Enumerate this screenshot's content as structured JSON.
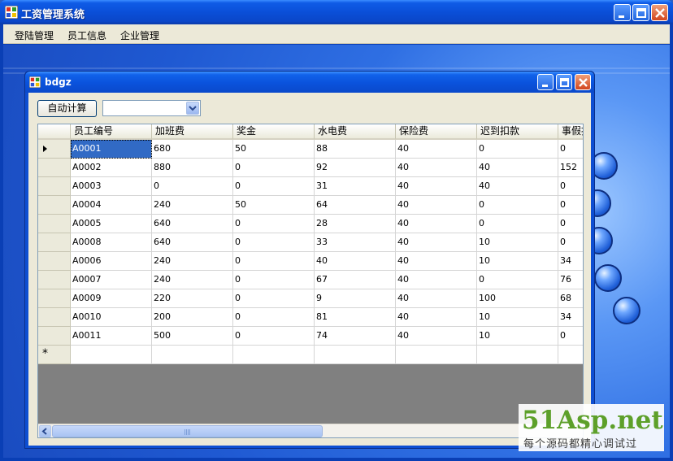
{
  "window": {
    "title": "工资管理系统"
  },
  "menu": [
    {
      "label": "登陆管理"
    },
    {
      "label": "员工信息"
    },
    {
      "label": "企业管理"
    }
  ],
  "child_window": {
    "title": "bdgz"
  },
  "toolbar": {
    "auto_calc_label": "自动计算",
    "combo_value": ""
  },
  "grid": {
    "columns": [
      "员工编号",
      "加班费",
      "奖金",
      "水电费",
      "保险费",
      "迟到扣款",
      "事假扣款"
    ],
    "rows": [
      [
        "A0001",
        "680",
        "50",
        "88",
        "40",
        "0",
        "0"
      ],
      [
        "A0002",
        "880",
        "0",
        "92",
        "40",
        "40",
        "152"
      ],
      [
        "A0003",
        "0",
        "0",
        "31",
        "40",
        "40",
        "0"
      ],
      [
        "A0004",
        "240",
        "50",
        "64",
        "40",
        "0",
        "0"
      ],
      [
        "A0005",
        "640",
        "0",
        "28",
        "40",
        "0",
        "0"
      ],
      [
        "A0008",
        "640",
        "0",
        "33",
        "40",
        "10",
        "0"
      ],
      [
        "A0006",
        "240",
        "0",
        "40",
        "40",
        "10",
        "34"
      ],
      [
        "A0007",
        "240",
        "0",
        "67",
        "40",
        "0",
        "76"
      ],
      [
        "A0009",
        "220",
        "0",
        "9",
        "40",
        "100",
        "68"
      ],
      [
        "A0010",
        "200",
        "0",
        "81",
        "40",
        "10",
        "34"
      ],
      [
        "A0011",
        "500",
        "0",
        "74",
        "40",
        "10",
        "0"
      ]
    ],
    "new_row_marker": "*"
  },
  "watermark": {
    "title": "51Asp.net",
    "subtitle": "每个源码都精心调试过"
  },
  "colors": {
    "selection": "#316ac5",
    "title_bar": "#0a52dc",
    "watermark_green": "#5da02a"
  }
}
